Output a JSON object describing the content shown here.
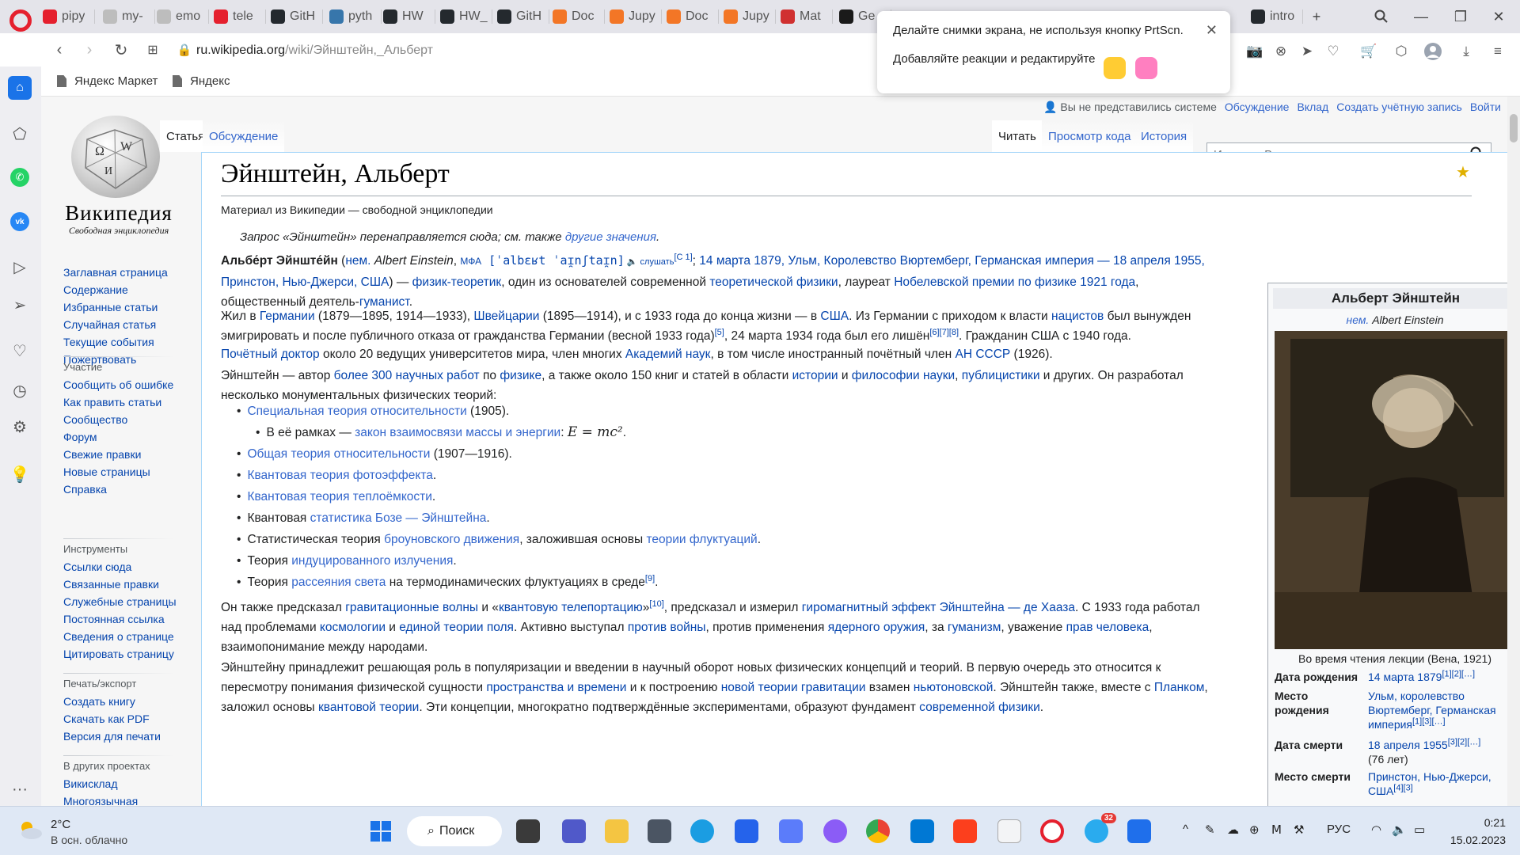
{
  "browser": {
    "tabs": [
      {
        "label": "pipy",
        "color": "#e5202e"
      },
      {
        "label": "my-",
        "color": "#bdbdbd"
      },
      {
        "label": "emo",
        "color": "#bdbdbd"
      },
      {
        "label": "tele",
        "color": "#e5202e"
      },
      {
        "label": "GitH",
        "color": "#24292e"
      },
      {
        "label": "pyth",
        "color": "#3776ab"
      },
      {
        "label": "HW",
        "color": "#24292e"
      },
      {
        "label": "HW_",
        "color": "#24292e"
      },
      {
        "label": "GitH",
        "color": "#24292e"
      },
      {
        "label": "Doc",
        "color": "#f37626"
      },
      {
        "label": "Jupy",
        "color": "#f37626"
      },
      {
        "label": "Doc",
        "color": "#f37626"
      },
      {
        "label": "Jupy",
        "color": "#f37626"
      },
      {
        "label": "Mat",
        "color": "#d03030"
      },
      {
        "label": "Ge",
        "color": "#1a1a1a"
      },
      {
        "label": "intro",
        "color": "#24292e"
      }
    ],
    "url_host": "ru.wikipedia.org",
    "url_path": "/wiki/Эйнштейн,_Альберт",
    "bookmarks": [
      "Яндекс Маркет",
      "Яндекс"
    ]
  },
  "notification": {
    "line1": "Делайте снимки экрана, не используя кнопку PrtScn.",
    "line2": "Добавляйте реакции и редактируйте"
  },
  "wiki": {
    "logo_title": "Википедия",
    "logo_tagline": "Свободная энциклопедия",
    "personal": {
      "not_logged": "Вы не представились системе",
      "talk": "Обсуждение",
      "contrib": "Вклад",
      "create": "Создать учётную запись",
      "login": "Войти"
    },
    "tabs": {
      "article": "Статья",
      "talk": "Обсуждение",
      "read": "Читать",
      "source": "Просмотр кода",
      "history": "История"
    },
    "search_placeholder": "Искать в Википедии",
    "nav": [
      "Заглавная страница",
      "Содержание",
      "Избранные статьи",
      "Случайная статья",
      "Текущие события",
      "Пожертвовать"
    ],
    "participation_head": "Участие",
    "participation": [
      "Сообщить об ошибке",
      "Как править статьи",
      "Сообщество",
      "Форум",
      "Свежие правки",
      "Новые страницы",
      "Справка"
    ],
    "tools_head": "Инструменты",
    "tools": [
      "Ссылки сюда",
      "Связанные правки",
      "Служебные страницы",
      "Постоянная ссылка",
      "Сведения о странице",
      "Цитировать страницу"
    ],
    "print_head": "Печать/экспорт",
    "print": [
      "Создать книгу",
      "Скачать как PDF",
      "Версия для печати"
    ],
    "other_head": "В других проектах",
    "other": [
      "Викисклад",
      "Многоязычная"
    ],
    "title": "Эйнштейн, Альберт",
    "subtitle": "Материал из Википедии — свободной энциклопедии",
    "hatnote_a": "Запрос «Эйнштейн» перенаправляется сюда; см. также ",
    "hatnote_b": "другие значения",
    "hatnote_c": ".",
    "p1": {
      "bold": "Альбе́рт Эйнште́йн",
      "a": " (",
      "nem": "нем.",
      "latin": " Albert Einstein",
      "b": ", ",
      "ipa_label": "МФА",
      "ipa": " [ˈalbɛʁt ˈaɪ̯nʃtaɪ̯n]",
      "listen": " 🔈 слушать",
      "ref1": "[С 1]",
      "c": "; ",
      "born": "14 марта 1879, Ульм, Королевство Вюртемберг, Германская империя — 18 апреля 1955, Принстон, Нью-Джерси, США",
      "d": ") — ",
      "phys": "физик-теоретик",
      "e": ", один из основателей современной ",
      "theo": "теоретической физики",
      "f": ", лауреат ",
      "nobel": "Нобелевской премии по физике 1921 года",
      "g": ", общественный деятель-",
      "hum": "гуманист",
      "h": "."
    },
    "p2": {
      "a": "Жил в ",
      "ger": "Германии",
      "b": " (1879—1895, 1914—1933), ",
      "swi": "Швейцарии",
      "c": " (1895—1914), и с 1933 года до конца жизни — в ",
      "usa": "США",
      "d": ". Из Германии с приходом к власти ",
      "nazi": "нацистов",
      "e": " был вынужден эмигрировать и после публичного отказа от гражданства Германии (весной 1933 года)",
      "r5": "[5]",
      "f": ", 24 марта 1934 года был его лишён",
      "r678": "[6][7][8]",
      "g": ". Гражданин США с 1940 года."
    },
    "p3": {
      "hon": "Почётный доктор",
      "a": " около 20 ведущих университетов мира, член многих ",
      "acad": "Академий наук",
      "b": ", в том числе иностранный почётный член ",
      "ussr": "АН СССР",
      "c": " (1926)."
    },
    "p4": {
      "a": "Эйнштейн — автор ",
      "works": "более 300 научных работ",
      "b": " по ",
      "phys": "физике",
      "c": ", а также около 150 книг и статей в области ",
      "hist": "истории",
      "d": " и ",
      "philo": "философии науки",
      "e": ", ",
      "pub": "публицистики",
      "f": " и других. Он разработал несколько монументальных физических теорий:"
    },
    "list": [
      {
        "link": "Специальная теория относительности",
        "rest": " (1905)."
      },
      {
        "pre": "В её рамках — ",
        "link": "закон взаимосвязи массы и энергии",
        "rest": ": ",
        "formula": "E = mc²",
        "dot": "."
      },
      {
        "link": "Общая теория относительности",
        "rest": " (1907—1916)."
      },
      {
        "link": "Квантовая теория фотоэффекта",
        "rest": "."
      },
      {
        "link": "Квантовая теория теплоёмкости",
        "rest": "."
      },
      {
        "pre": "Квантовая ",
        "link": "статистика Бозе — Эйнштейна",
        "rest": "."
      },
      {
        "pre": "Статистическая теория ",
        "link": "броуновского движения",
        "rest": ", заложившая основы ",
        "link2": "теории флуктуаций",
        "rest2": "."
      },
      {
        "pre": "Теория ",
        "link": "индуцированного излучения",
        "rest": "."
      },
      {
        "pre": "Теория ",
        "link": "рассеяния света",
        "rest": " на термодинамических флуктуациях в среде",
        "ref": "[9]",
        "rest2": "."
      }
    ],
    "p5": {
      "a": "Он также предсказал ",
      "gw": "гравитационные волны",
      "b": " и «",
      "qt": "квантовую телепортацию",
      "c": "»",
      "r10": "[10]",
      "d": ", предсказал и измерил ",
      "gm": "гиромагнитный эффект Эйнштейна — де Хааза",
      "e": ". С 1933 года работал над проблемами ",
      "cosmo": "космологии",
      "f": " и ",
      "uft": "единой теории поля",
      "g": ". Активно выступал ",
      "war": "против войны",
      "h": ", против применения ",
      "nuc": "ядерного оружия",
      "i": ", за ",
      "hum": "гуманизм",
      "j": ", уважение ",
      "hr": "прав человека",
      "k": ", взаимопонимание между народами."
    },
    "p6": {
      "a": "Эйнштейну принадлежит решающая роль в популяризации и введении в научный оборот новых физических концепций и теорий. В первую очередь это относится к пересмотру понимания физической сущности ",
      "st": "пространства и времени",
      "b": " и к построению ",
      "ngr": "новой теории гравитации",
      "c": " взамен ",
      "newt": "ньютоновской",
      "d": ". Эйнштейн также, вместе с ",
      "planck": "Планком",
      "e": ", заложил основы ",
      "qtheory": "квантовой теории",
      "f": ". Эти концепции, многократно подтверждённые экспериментами, образуют фундамент ",
      "modern": "современной физики",
      "g": "."
    },
    "infobox": {
      "name": "Альберт Эйнштейн",
      "nem": "нем.",
      "native": " Albert Einstein",
      "caption": "Во время чтения лекции (Вена, 1921)",
      "birth_key": "Дата рождения",
      "birth_val": "14 марта 1879",
      "birth_ref": "[1][2][…]",
      "birthplace_key1": "Место",
      "birthplace_key2": "рождения",
      "birthplace_val": "Ульм, королевство Вюртемберг, Германская империя",
      "birthplace_ref": "[1][3][…]",
      "death_key": "Дата смерти",
      "death_val": "18 апреля 1955",
      "death_ref": "[3][2][…]",
      "death_age": "(76 лет)",
      "deathplace_key": "Место смерти",
      "deathplace_val": "Принстон, Нью-Джерси, США",
      "deathplace_ref": "[4][3]"
    }
  },
  "taskbar": {
    "temp": "2°C",
    "weather": "В осн. облачно",
    "search": "Поиск",
    "lang": "РУС",
    "time": "0:21",
    "date": "15.02.2023",
    "telegram_badge": "32"
  }
}
